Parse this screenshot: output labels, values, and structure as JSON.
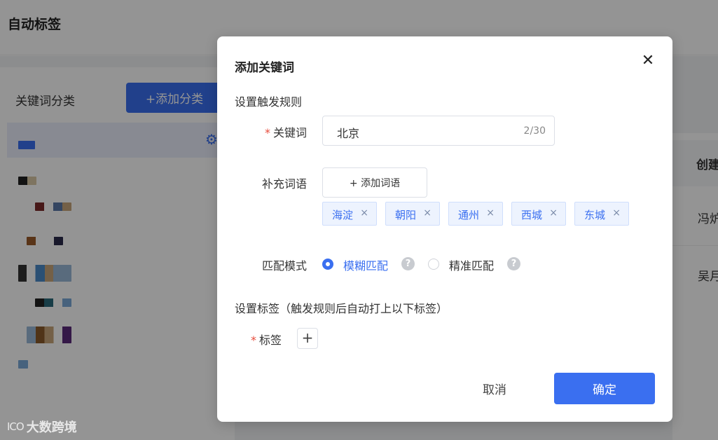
{
  "page": {
    "title": "自动标签",
    "category_label": "关键词分类",
    "add_category_label": "+添加分类",
    "table": {
      "column_header": "创建",
      "rows": [
        "冯炉",
        "吴月"
      ]
    },
    "brand": {
      "logo": "ICO",
      "name": "大数跨境"
    }
  },
  "dialog": {
    "title": "添加关键词",
    "close_icon": "close-icon",
    "trigger_section_title": "设置触发规则",
    "keyword": {
      "required_mark": "*",
      "label": "关键词",
      "value": "北京",
      "count": "2/30"
    },
    "supplement": {
      "label": "补充词语",
      "add_button": "+ 添加词语",
      "terms": [
        "海淀",
        "朝阳",
        "通州",
        "西城",
        "东城"
      ],
      "remove_glyph": "×"
    },
    "match_mode": {
      "label": "匹配模式",
      "options": [
        {
          "label": "模糊匹配",
          "checked": true
        },
        {
          "label": "精准匹配",
          "checked": false
        }
      ],
      "help_glyph": "?"
    },
    "tag_section_title": "设置标签（触发规则后自动打上以下标签）",
    "tags": {
      "required_mark": "*",
      "label": "标签",
      "add_glyph": "+"
    },
    "cancel_label": "取消",
    "confirm_label": "确定"
  },
  "colors": {
    "primary": "#3a6ff0",
    "required": "#e74c3c",
    "overlay": "rgba(0,0,0,0.42)"
  }
}
